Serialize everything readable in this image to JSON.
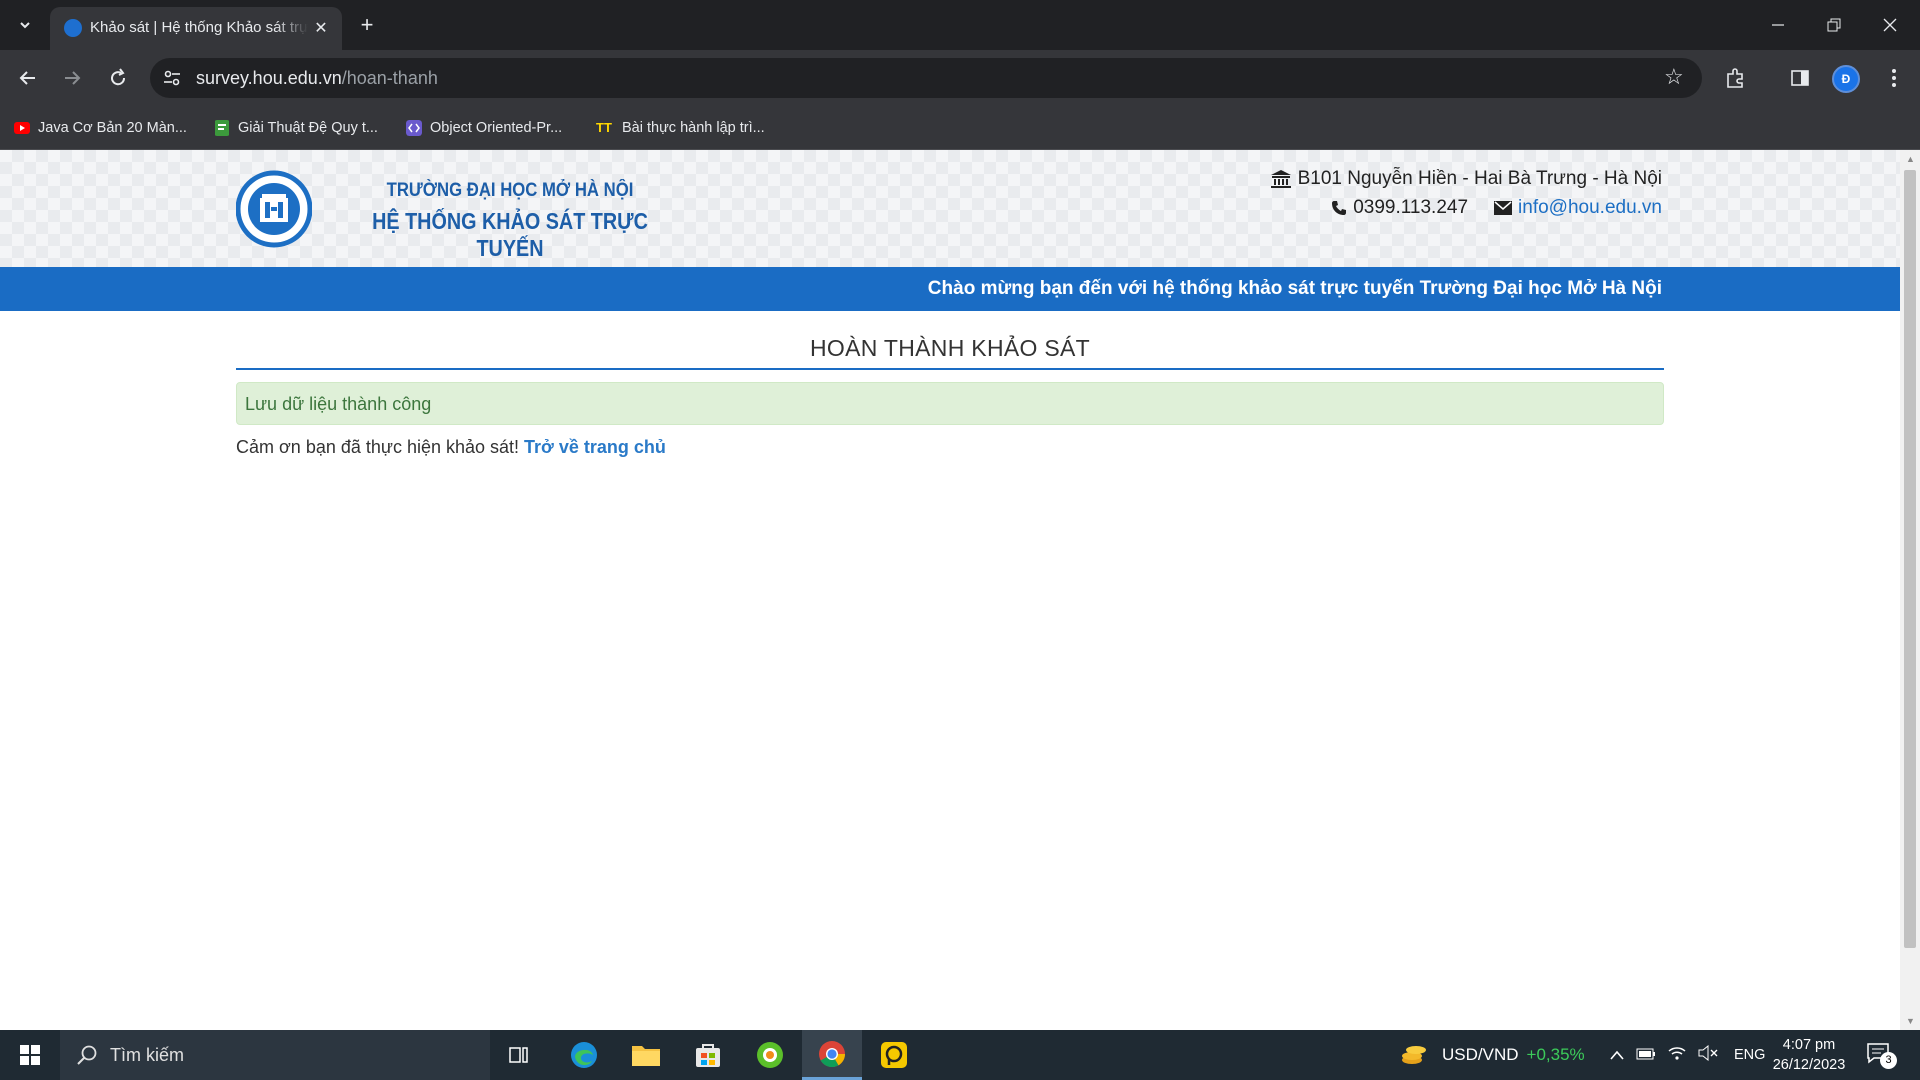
{
  "browser": {
    "tab_title": "Khảo sát | Hệ thống Khảo sát trực tuyến",
    "url_host": "survey.hou.edu.vn",
    "url_path": "/hoan-thanh",
    "profile_initial": "Đ",
    "bookmarks": [
      {
        "label": "Java Cơ Bản 20 Màn...",
        "icon": "youtube-icon",
        "color": "#ff0000"
      },
      {
        "label": "Giải Thuật Đệ Quy t...",
        "icon": "green-doc-icon",
        "color": "#3c9a3c"
      },
      {
        "label": "Object Oriented-Pr...",
        "icon": "code-icon",
        "color": "#6a5acd"
      },
      {
        "label": "Bài thực hành lập trì...",
        "icon": "tt-icon",
        "color": "#ffd700"
      }
    ]
  },
  "site": {
    "school_name": "TRƯỜNG ĐẠI HỌC MỞ HÀ NỘI",
    "system_name": "HỆ THỐNG KHẢO SÁT TRỰC TUYẾN",
    "address": "B101 Nguyễn Hiền - Hai Bà Trưng - Hà Nội",
    "phone": "0399.113.247",
    "email": "info@hou.edu.vn",
    "welcome": "Chào mừng bạn đến với hệ thống khảo sát trực tuyến Trường Đại học Mở Hà Nội",
    "brand_color": "#1a6cc4"
  },
  "main": {
    "title": "HOÀN THÀNH KHẢO SÁT",
    "alert": "Lưu dữ liệu thành công",
    "thanks": "Cảm ơn bạn đã thực hiện khảo sát!",
    "home_link": "Trở về trang chủ"
  },
  "taskbar": {
    "search_placeholder": "Tìm kiếm",
    "currency": "USD/VND",
    "currency_change": "+0,35%",
    "language": "ENG",
    "time": "4:07 pm",
    "date": "26/12/2023",
    "notification_count": "3"
  }
}
